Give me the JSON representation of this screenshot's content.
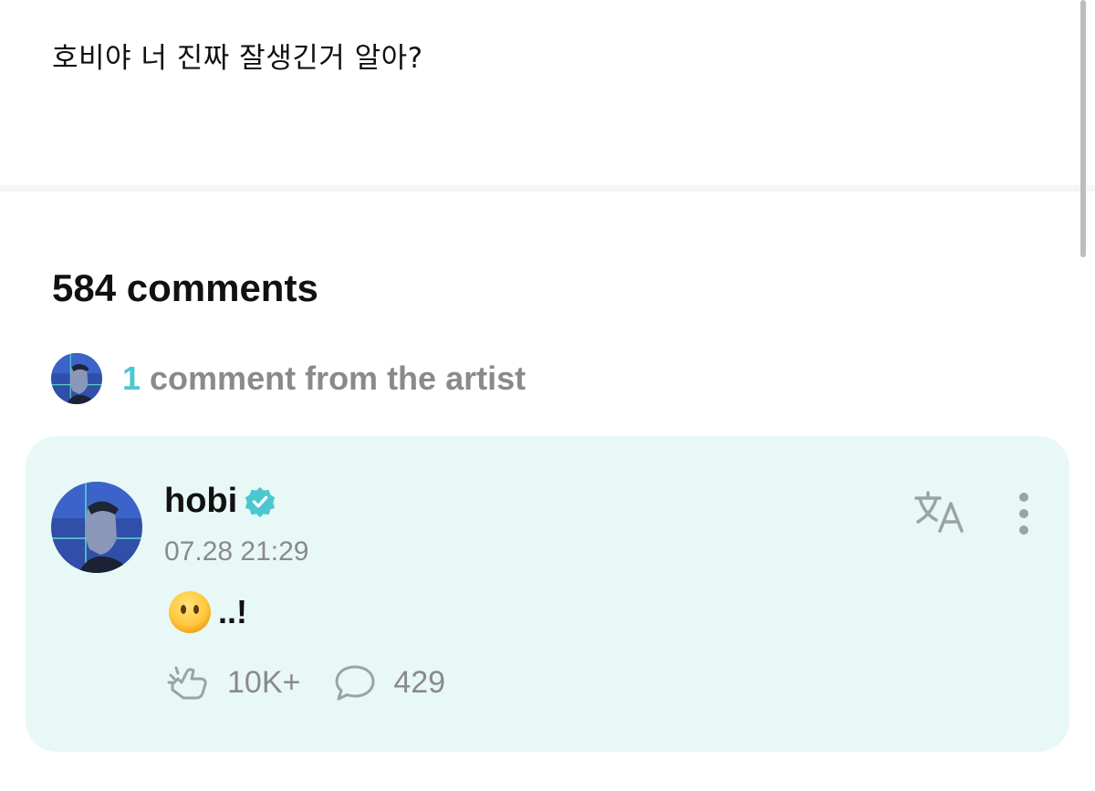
{
  "post": {
    "text": "호비야 너 진짜 잘생긴거 알아?"
  },
  "comments": {
    "count_label": "584 comments",
    "artist_count": "1",
    "artist_label": "comment from the artist"
  },
  "artist_comment": {
    "username": "hobi",
    "timestamp": "07.28 21:29",
    "emoji": "face-without-mouth",
    "text": "..!",
    "likes": "10K+",
    "replies": "429"
  },
  "icons": {
    "verified": "verified-badge-icon",
    "translate": "translate-icon",
    "more": "more-vertical-icon",
    "like": "like-icon",
    "reply": "reply-icon"
  },
  "colors": {
    "accent": "#4cc7d0",
    "card_background": "#e8f8f6",
    "muted_text": "#8a8a8a",
    "icon_gray": "#9aa3a6"
  }
}
